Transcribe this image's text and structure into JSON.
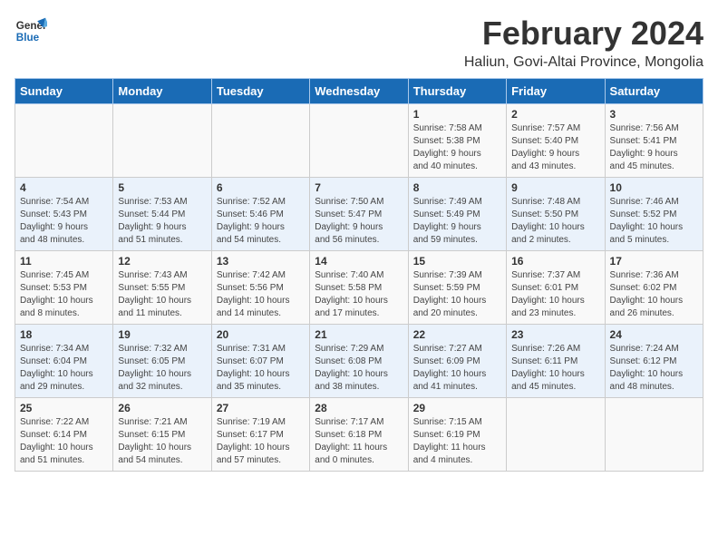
{
  "header": {
    "logo_line1": "General",
    "logo_line2": "Blue",
    "month_title": "February 2024",
    "subtitle": "Haliun, Govi-Altai Province, Mongolia"
  },
  "weekdays": [
    "Sunday",
    "Monday",
    "Tuesday",
    "Wednesday",
    "Thursday",
    "Friday",
    "Saturday"
  ],
  "weeks": [
    [
      {
        "num": "",
        "info": ""
      },
      {
        "num": "",
        "info": ""
      },
      {
        "num": "",
        "info": ""
      },
      {
        "num": "",
        "info": ""
      },
      {
        "num": "1",
        "info": "Sunrise: 7:58 AM\nSunset: 5:38 PM\nDaylight: 9 hours\nand 40 minutes."
      },
      {
        "num": "2",
        "info": "Sunrise: 7:57 AM\nSunset: 5:40 PM\nDaylight: 9 hours\nand 43 minutes."
      },
      {
        "num": "3",
        "info": "Sunrise: 7:56 AM\nSunset: 5:41 PM\nDaylight: 9 hours\nand 45 minutes."
      }
    ],
    [
      {
        "num": "4",
        "info": "Sunrise: 7:54 AM\nSunset: 5:43 PM\nDaylight: 9 hours\nand 48 minutes."
      },
      {
        "num": "5",
        "info": "Sunrise: 7:53 AM\nSunset: 5:44 PM\nDaylight: 9 hours\nand 51 minutes."
      },
      {
        "num": "6",
        "info": "Sunrise: 7:52 AM\nSunset: 5:46 PM\nDaylight: 9 hours\nand 54 minutes."
      },
      {
        "num": "7",
        "info": "Sunrise: 7:50 AM\nSunset: 5:47 PM\nDaylight: 9 hours\nand 56 minutes."
      },
      {
        "num": "8",
        "info": "Sunrise: 7:49 AM\nSunset: 5:49 PM\nDaylight: 9 hours\nand 59 minutes."
      },
      {
        "num": "9",
        "info": "Sunrise: 7:48 AM\nSunset: 5:50 PM\nDaylight: 10 hours\nand 2 minutes."
      },
      {
        "num": "10",
        "info": "Sunrise: 7:46 AM\nSunset: 5:52 PM\nDaylight: 10 hours\nand 5 minutes."
      }
    ],
    [
      {
        "num": "11",
        "info": "Sunrise: 7:45 AM\nSunset: 5:53 PM\nDaylight: 10 hours\nand 8 minutes."
      },
      {
        "num": "12",
        "info": "Sunrise: 7:43 AM\nSunset: 5:55 PM\nDaylight: 10 hours\nand 11 minutes."
      },
      {
        "num": "13",
        "info": "Sunrise: 7:42 AM\nSunset: 5:56 PM\nDaylight: 10 hours\nand 14 minutes."
      },
      {
        "num": "14",
        "info": "Sunrise: 7:40 AM\nSunset: 5:58 PM\nDaylight: 10 hours\nand 17 minutes."
      },
      {
        "num": "15",
        "info": "Sunrise: 7:39 AM\nSunset: 5:59 PM\nDaylight: 10 hours\nand 20 minutes."
      },
      {
        "num": "16",
        "info": "Sunrise: 7:37 AM\nSunset: 6:01 PM\nDaylight: 10 hours\nand 23 minutes."
      },
      {
        "num": "17",
        "info": "Sunrise: 7:36 AM\nSunset: 6:02 PM\nDaylight: 10 hours\nand 26 minutes."
      }
    ],
    [
      {
        "num": "18",
        "info": "Sunrise: 7:34 AM\nSunset: 6:04 PM\nDaylight: 10 hours\nand 29 minutes."
      },
      {
        "num": "19",
        "info": "Sunrise: 7:32 AM\nSunset: 6:05 PM\nDaylight: 10 hours\nand 32 minutes."
      },
      {
        "num": "20",
        "info": "Sunrise: 7:31 AM\nSunset: 6:07 PM\nDaylight: 10 hours\nand 35 minutes."
      },
      {
        "num": "21",
        "info": "Sunrise: 7:29 AM\nSunset: 6:08 PM\nDaylight: 10 hours\nand 38 minutes."
      },
      {
        "num": "22",
        "info": "Sunrise: 7:27 AM\nSunset: 6:09 PM\nDaylight: 10 hours\nand 41 minutes."
      },
      {
        "num": "23",
        "info": "Sunrise: 7:26 AM\nSunset: 6:11 PM\nDaylight: 10 hours\nand 45 minutes."
      },
      {
        "num": "24",
        "info": "Sunrise: 7:24 AM\nSunset: 6:12 PM\nDaylight: 10 hours\nand 48 minutes."
      }
    ],
    [
      {
        "num": "25",
        "info": "Sunrise: 7:22 AM\nSunset: 6:14 PM\nDaylight: 10 hours\nand 51 minutes."
      },
      {
        "num": "26",
        "info": "Sunrise: 7:21 AM\nSunset: 6:15 PM\nDaylight: 10 hours\nand 54 minutes."
      },
      {
        "num": "27",
        "info": "Sunrise: 7:19 AM\nSunset: 6:17 PM\nDaylight: 10 hours\nand 57 minutes."
      },
      {
        "num": "28",
        "info": "Sunrise: 7:17 AM\nSunset: 6:18 PM\nDaylight: 11 hours\nand 0 minutes."
      },
      {
        "num": "29",
        "info": "Sunrise: 7:15 AM\nSunset: 6:19 PM\nDaylight: 11 hours\nand 4 minutes."
      },
      {
        "num": "",
        "info": ""
      },
      {
        "num": "",
        "info": ""
      }
    ]
  ]
}
